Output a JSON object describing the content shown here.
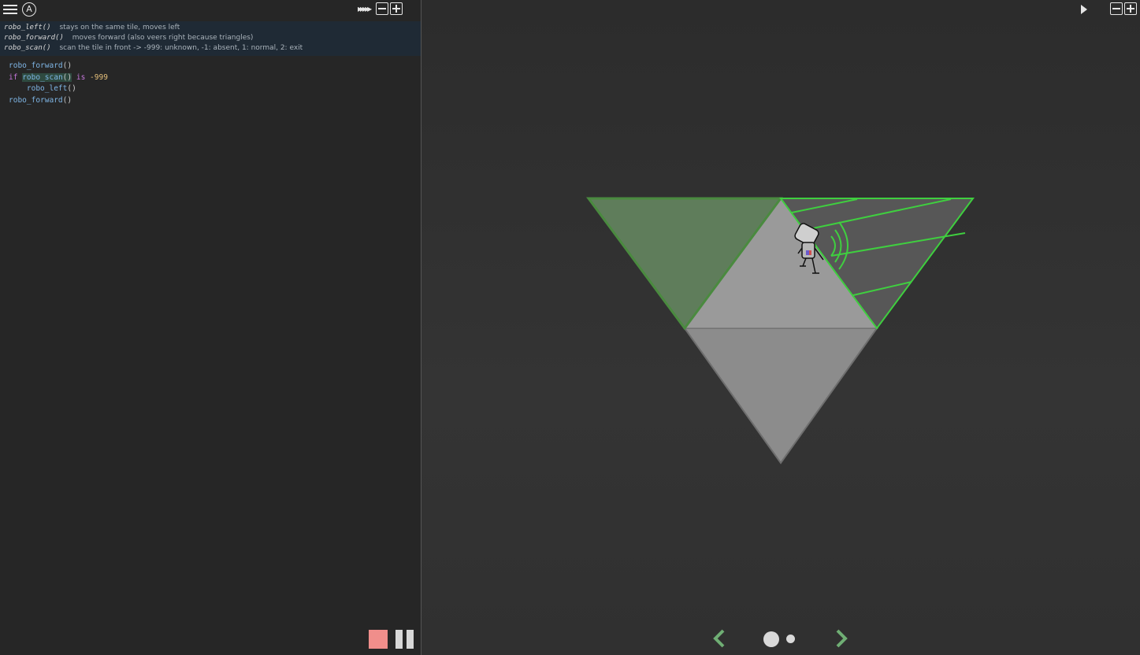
{
  "docs": [
    {
      "fn": "robo_left()",
      "desc": "stays on the same tile, moves left"
    },
    {
      "fn": "robo_forward()",
      "desc": "moves forward (also veers right because triangles)"
    },
    {
      "fn": "robo_scan()",
      "desc": "scan the tile in front -> -999: unknown, -1: absent, 1: normal, 2: exit"
    }
  ],
  "code": {
    "line1_fn": "robo_forward",
    "line1_paren": "()",
    "line2_kw": "if",
    "line2_fn": "robo_scan",
    "line2_paren": "()",
    "line2_is": "is",
    "line2_num": "-999",
    "line3_fn": "robo_left",
    "line3_paren": "()",
    "line4_fn": "robo_forward",
    "line4_paren": "()"
  },
  "toolbar": {
    "menu": "menu-icon",
    "autocomplete_letter": "A",
    "fast_forward": "▸▸▸▸▸",
    "zoom_out": "zoom-out-icon",
    "zoom_in": "zoom-in-icon"
  },
  "playback": {
    "stop_color": "#f08e8b",
    "pause_color": "#d8d8d8"
  },
  "viewport": {
    "tile_colors": {
      "visited": "#5e7f5a",
      "normal": "#8a8a8a",
      "scanned": "#555555",
      "scan_line": "#3fcf3f"
    },
    "pager": {
      "pages": 2,
      "current": 1
    }
  }
}
